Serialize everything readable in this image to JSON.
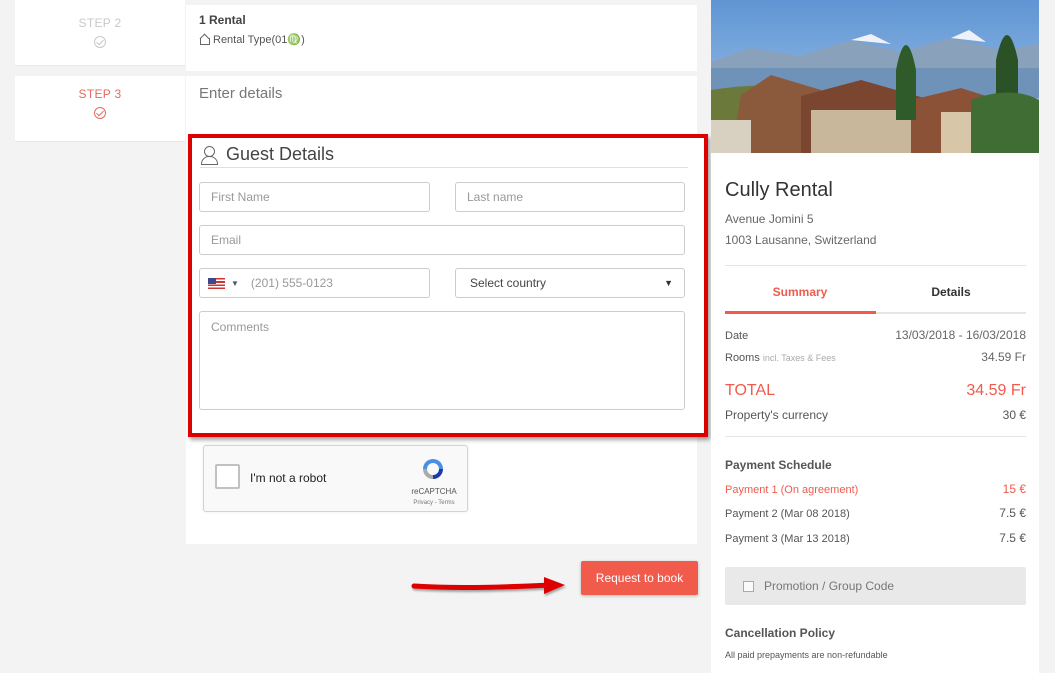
{
  "steps": [
    {
      "label": "STEP 2",
      "title": "1 Rental",
      "subtitle": "Rental Type(01♍)"
    },
    {
      "label": "STEP 3",
      "title": "Enter details"
    }
  ],
  "guest_details": {
    "title": "Guest Details",
    "first_name_placeholder": "First Name",
    "last_name_placeholder": "Last name",
    "email_placeholder": "Email",
    "phone_placeholder": "(201) 555-0123",
    "country_selected": "Select country",
    "comments_placeholder": "Comments"
  },
  "captcha": {
    "label": "I'm not a robot",
    "brand": "reCAPTCHA",
    "terms": "Privacy - Terms"
  },
  "request_button": "Request to book",
  "property": {
    "name": "Cully Rental",
    "address_line1": "Avenue Jomini 5",
    "address_line2": "1003  Lausanne,  Switzerland"
  },
  "tabs": {
    "summary": "Summary",
    "details": "Details"
  },
  "summary": {
    "date_label": "Date",
    "date_value": "13/03/2018 - 16/03/2018",
    "rooms_label": "Rooms",
    "rooms_note": "incl. Taxes & Fees",
    "rooms_value": "34.59 Fr",
    "total_label": "TOTAL",
    "total_value": "34.59 Fr",
    "currency_label": "Property's currency",
    "currency_value": "30 €"
  },
  "payment_schedule": {
    "title": "Payment Schedule",
    "items": [
      {
        "label": "Payment 1 (On agreement)",
        "amount": "15 €"
      },
      {
        "label": "Payment 2 (Mar 08 2018)",
        "amount": "7.5 €"
      },
      {
        "label": "Payment 3 (Mar 13 2018)",
        "amount": "7.5 €"
      }
    ]
  },
  "promo": {
    "label": "Promotion / Group Code"
  },
  "cancellation": {
    "title": "Cancellation Policy",
    "text": "All paid prepayments are non-refundable"
  },
  "colors": {
    "accent": "#f05b4c",
    "highlight_border": "#dd0000"
  }
}
